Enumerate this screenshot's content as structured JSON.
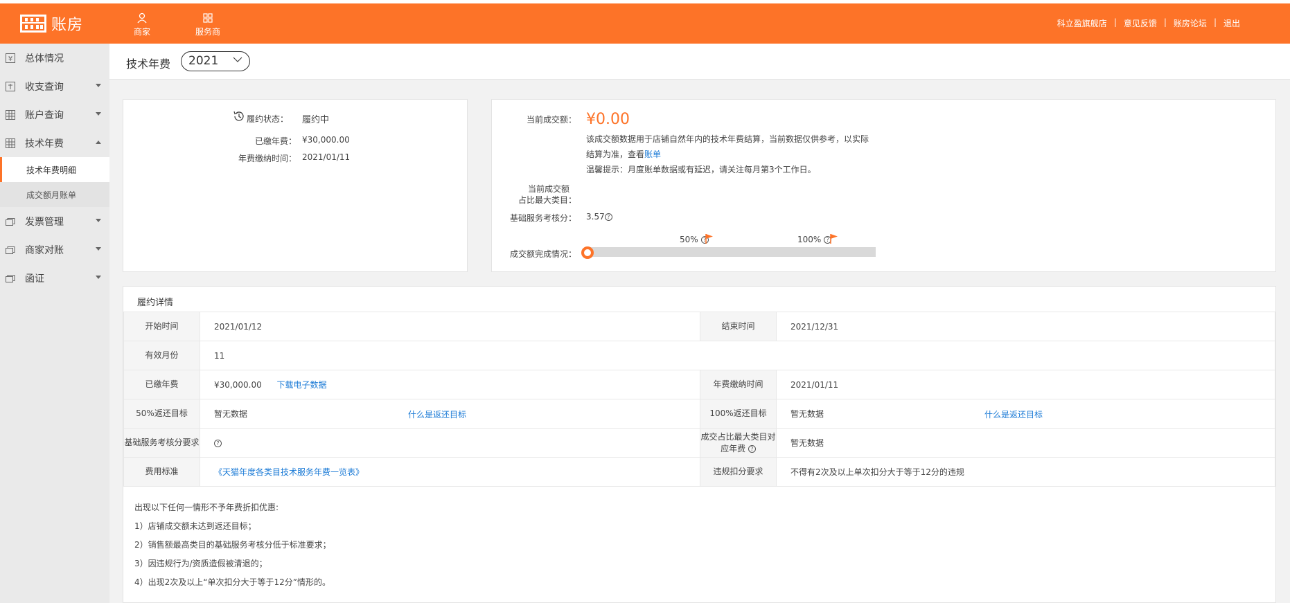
{
  "topbar": {
    "logo_text": "账房",
    "nav": [
      {
        "label": "商家",
        "icon": "user-icon"
      },
      {
        "label": "服务商",
        "icon": "apps-icon"
      }
    ],
    "links": [
      "科立盈旗舰店",
      "意见反馈",
      "账房论坛",
      "退出"
    ],
    "separator": "|",
    "bg_color": "#fd7328"
  },
  "sidebar": {
    "items": [
      {
        "label": "总体情况",
        "icon": "yen-icon"
      },
      {
        "label": "收支查询",
        "icon": "ledger-icon"
      },
      {
        "label": "账户查询",
        "icon": "grid-icon"
      },
      {
        "label": "技术年费",
        "icon": "grid-icon"
      }
    ],
    "sub_items": [
      "技术年费明细",
      "成交额月账单"
    ],
    "items_after": [
      {
        "label": "发票管理",
        "icon": "stack-icon"
      },
      {
        "label": "商家对账",
        "icon": "stack-icon"
      },
      {
        "label": "函证",
        "icon": "stack-icon"
      }
    ]
  },
  "header": {
    "title": "技术年费",
    "year": "2021"
  },
  "status_card": {
    "status_label": "履约状态：",
    "status_value": "履约中",
    "paid_label": "已缴年费：",
    "paid_value": "¥30,000.00",
    "paid_time_label": "年费缴纳时间：",
    "paid_time_value": "2021/01/11"
  },
  "sales_card": {
    "amount_label": "当前成交额：",
    "amount_value": "¥0.00",
    "note1": "该成交额数据用于店铺自然年内的技术年费结算，当前数据仅供参考，以实际",
    "note2_prefix": "结算为准，查看",
    "note2_link": "账单",
    "note3": "温馨提示：月度账单数据或有延迟，请关注每月第3个工作日。",
    "ratio_label_1": "当前成交额",
    "ratio_label_2": "占比最大类目：",
    "score_label": "基础服务考核分：",
    "score_value": "3.57",
    "progress_label": "成交额完成情况：",
    "progress_value": 0,
    "marker_50": "50%",
    "marker_100": "100%"
  },
  "detail": {
    "title": "履约详情",
    "start_label": "开始时间",
    "start_value": "2021/01/12",
    "end_label": "结束时间",
    "end_value": "2021/12/31",
    "months_label": "有效月份",
    "months_value": "11",
    "paid_label": "已缴年费",
    "paid_value": "¥30,000.00",
    "download_link": "下载电子数据",
    "paid_time_label": "年费缴纳时间",
    "paid_time_value": "2021/01/11",
    "target50_label": "50%返还目标",
    "target50_value": "暂无数据",
    "target_help_link": "什么是返还目标",
    "target100_label": "100%返还目标",
    "target100_value": "暂无数据",
    "score_req_label": "基础服务考核分要求",
    "category_fee_label": "成交占比最大类目对应年费",
    "category_fee_value": "暂无数据",
    "fee_std_label": "费用标准",
    "fee_std_link": "《天猫年度各类目技术服务年费一览表》",
    "violation_label": "违规扣分要求",
    "violation_value": "不得有2次及以上单次扣分大于等于12分的违规"
  },
  "notes": [
    "出现以下任何一情形不予年费折扣优惠:",
    "1）店铺成交额未达到返还目标；",
    "2）销售额最高类目的基础服务考核分低于标准要求；",
    "3）因违规行为/资质造假被清退的；",
    "4）出现2次及以上“单次扣分大于等于12分”情形的。"
  ]
}
